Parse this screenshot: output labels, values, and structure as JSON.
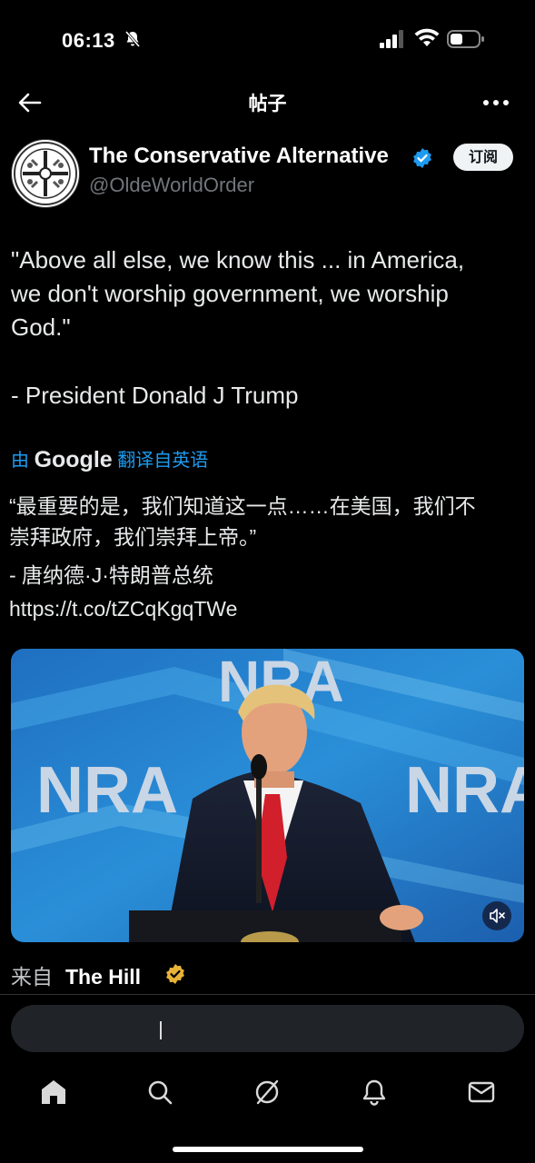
{
  "status_bar": {
    "time": "06:13"
  },
  "header": {
    "title": "帖子"
  },
  "post": {
    "author_name": "The Conservative Alternative",
    "author_handle": "@OldeWorldOrder",
    "subscribe_label": "订阅",
    "text_lines": [
      "\"Above all else, we know this ... in America,",
      "we don't worship government, we worship",
      "God.\"",
      "- President Donald J Trump"
    ],
    "translation": {
      "prefix": "由",
      "brand": "Google",
      "suffix": "翻译自英语",
      "lines": [
        "“最重要的是，我们知道这一点……在美国，我们不",
        "崇拜政府，我们崇拜上帝。”",
        "- 唐纳德·J·特朗普总统"
      ],
      "link": "https://t.co/tZCqKgqTWe"
    },
    "media": {
      "banner_text": "NRA",
      "mute_icon": "speaker-muted-icon"
    },
    "source": {
      "prefix": "来自",
      "name": "The Hill"
    }
  },
  "reply_box": {
    "placeholder": ""
  },
  "bottom_nav": {
    "icons": [
      "home-icon",
      "search-icon",
      "grok-icon",
      "notifications-icon",
      "messages-icon"
    ]
  },
  "colors": {
    "accent": "#1d9bf0",
    "background": "#000000",
    "gold_badge": "#e8b339"
  }
}
